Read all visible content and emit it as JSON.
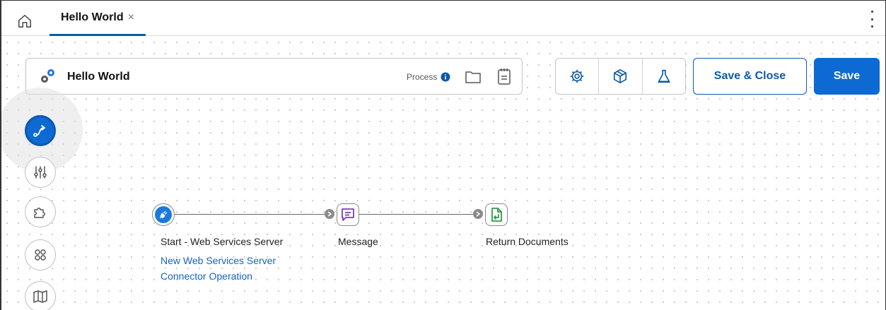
{
  "tab": {
    "title": "Hello World",
    "close": "×"
  },
  "process": {
    "name": "Hello World",
    "type_label": "Process"
  },
  "buttons": {
    "save_close": "Save & Close",
    "save": "Save"
  },
  "toolbar_icons": [
    "settings-gear-icon",
    "package-cube-icon",
    "test-flask-icon"
  ],
  "palette_icons": [
    "flow-route-icon",
    "sliders-icon",
    "puzzle-piece-icon",
    "components-grid-icon",
    "map-icon"
  ],
  "flow": {
    "start_label": "Start - Web Services Server",
    "start_operation": "New Web Services Server Connector Operation",
    "message_label": "Message",
    "return_label": "Return Documents"
  },
  "colors": {
    "accent": "#0d6ad2",
    "message_purple": "#7b3fbf",
    "return_green": "#2e9a48"
  }
}
